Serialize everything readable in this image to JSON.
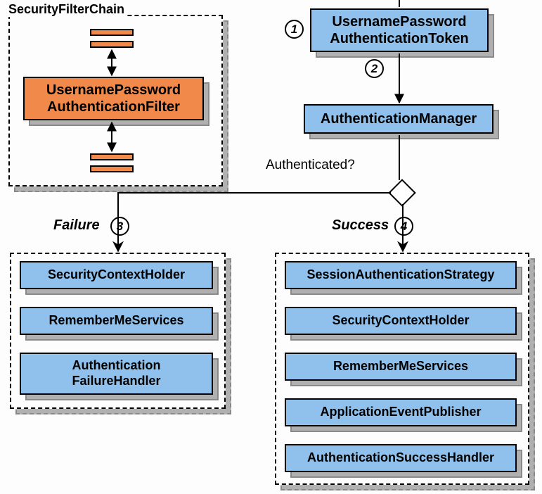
{
  "diagram": {
    "filterChainTitle": "SecurityFilterChain",
    "authFilter": "UsernamePassword\nAuthenticationFilter",
    "token": "UsernamePassword\nAuthenticationToken",
    "manager": "AuthenticationManager",
    "question": "Authenticated?",
    "failureLabel": "Failure",
    "successLabel": "Success",
    "steps": {
      "s1": "1",
      "s2": "2",
      "s3": "3",
      "s4": "4"
    },
    "failureItems": {
      "i0": "SecurityContextHolder",
      "i1": "RememberMeServices",
      "i2": "Authentication\nFailureHandler"
    },
    "successItems": {
      "i0": "SessionAuthenticationStrategy",
      "i1": "SecurityContextHolder",
      "i2": "RememberMeServices",
      "i3": "ApplicationEventPublisher",
      "i4": "AuthenticationSuccessHandler"
    }
  }
}
